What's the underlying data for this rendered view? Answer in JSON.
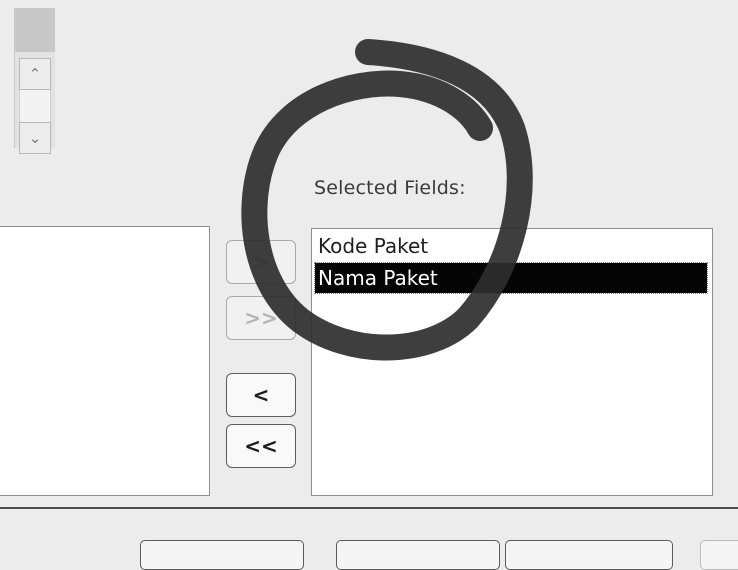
{
  "selected_fields": {
    "label": "Selected Fields:",
    "items": [
      "Kode Paket",
      "Nama Paket"
    ],
    "selected_item": "Nama Paket"
  },
  "move_buttons": {
    "add": ">",
    "add_all": ">>",
    "remove": "<",
    "remove_all": "<<"
  },
  "scrollbar": {
    "up_icon": "chevron-up",
    "down_icon": "chevron-down"
  },
  "annotation_circle": {
    "color": "#2e2e2e"
  }
}
